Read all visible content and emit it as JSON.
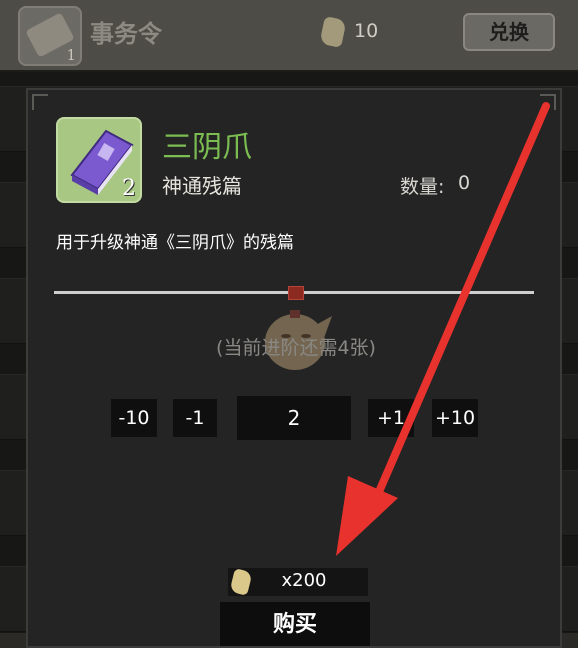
{
  "header": {
    "title": "事务令",
    "icon_count": "1",
    "currency_count": "10",
    "exchange_label": "兑换"
  },
  "dialog": {
    "item_name": "三阴爪",
    "item_type": "神通残篇",
    "item_count": "2",
    "quantity_label": "数量:",
    "quantity_value": "0",
    "description": "用于升级神通《三阴爪》的残篇",
    "remaining_text": "(当前进阶还需4张)",
    "stepper": {
      "minus10": "-10",
      "minus1": "-1",
      "value": "2",
      "plus1": "+1",
      "plus10": "+10"
    },
    "price": "x200",
    "buy_label": "购买"
  },
  "icons": {
    "header_item": "scroll-icon",
    "currency": "coin-icon",
    "item": "purple-book-icon",
    "mascot": "mascot-watermark-icon"
  },
  "colors": {
    "item_name": "#7cbd52",
    "item_icon_bg": "#a7c782",
    "arrow": "#e8322e"
  }
}
